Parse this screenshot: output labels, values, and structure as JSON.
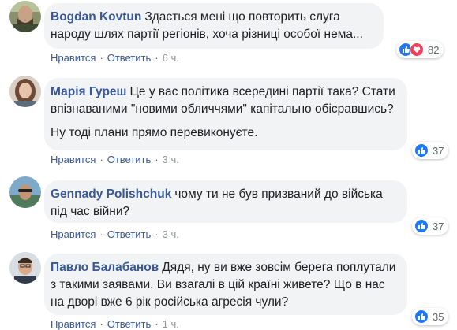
{
  "comments": [
    {
      "author": "Bogdan Kovtun",
      "text": "Здається мені що повторить слуга народу шлях партії регіонів, хоча різниці особої нема...",
      "reactions": {
        "count": "82",
        "types": [
          "like-icon",
          "love-icon"
        ]
      },
      "actions": {
        "like": "Нравится",
        "reply": "Ответить",
        "time": "6 ч."
      }
    },
    {
      "author": "Марія Гуреш",
      "text": "Це у вас політика всередині партії така? Стати впізнаваними \"новими обличчями\" капітально обісравшись?",
      "text2": "Ну тоді плани прямо перевиконуєте.",
      "reactions": {
        "count": "37",
        "types": [
          "like-icon"
        ]
      },
      "actions": {
        "like": "Нравится",
        "reply": "Ответить",
        "time": "3 ч."
      }
    },
    {
      "author": "Gennady Polishchuk",
      "text": "чому ти не був призваний до війська під час війни?",
      "reactions": {
        "count": "37",
        "types": [
          "like-icon"
        ]
      },
      "actions": {
        "like": "Нравится",
        "reply": "Ответить",
        "time": "3 ч."
      }
    },
    {
      "author": "Павло Балабанов",
      "text": "Дядя, ну ви вже зовсім берега поплутали з такими заявами. Ви взагалі в цій країні живете? Що в нас на дворі вже 6 рік російська агресія чули?",
      "reactions": {
        "count": "35",
        "types": [
          "like-icon"
        ]
      },
      "actions": {
        "like": "Нравится",
        "reply": "Ответить",
        "time": "1 ч."
      }
    }
  ],
  "colors": {
    "author": "#385898",
    "bubble": "#f2f3f5",
    "like": "#2078f4",
    "love": "#f33e58",
    "meta": "#90949c"
  }
}
